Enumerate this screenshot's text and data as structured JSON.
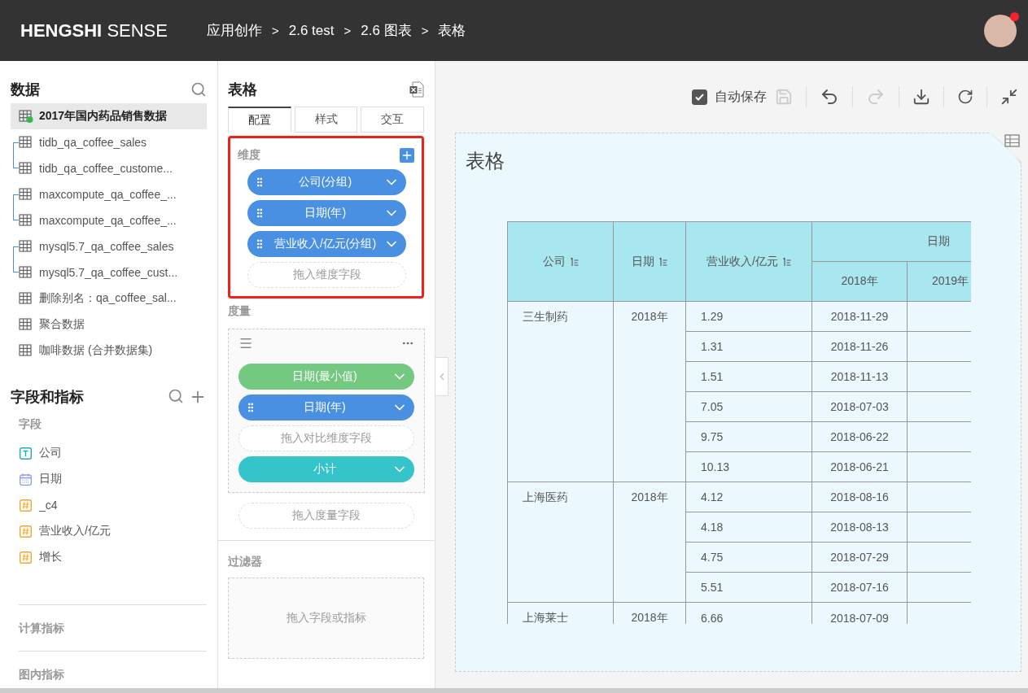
{
  "header": {
    "brand_bold": "HENGSHI",
    "brand_light": "SENSE",
    "separator": ">",
    "breadcrumb": [
      "应用创作",
      "2.6 test",
      "2.6 图表",
      "表格"
    ],
    "notification": true
  },
  "data_panel": {
    "title": "数据",
    "datasets": [
      {
        "kind": "single",
        "name": "2017年国内药品销售数据",
        "selected": true
      },
      {
        "kind": "group",
        "children": [
          {
            "name": "tidb_qa_coffee_sales",
            "selected": false
          },
          {
            "name": "tidb_qa_coffee_custome...",
            "selected": false
          }
        ]
      },
      {
        "kind": "group",
        "children": [
          {
            "name": "maxcompute_qa_coffee_...",
            "selected": false
          },
          {
            "name": "maxcompute_qa_coffee_...",
            "selected": false
          }
        ]
      },
      {
        "kind": "group",
        "children": [
          {
            "name": "mysql5.7_qa_coffee_sales",
            "selected": false
          },
          {
            "name": "mysql5.7_qa_coffee_cust...",
            "selected": false
          }
        ]
      },
      {
        "kind": "single",
        "name": "删除别名：qa_coffee_sal...",
        "selected": false
      },
      {
        "kind": "single",
        "name": "聚合数据",
        "selected": false
      },
      {
        "kind": "single",
        "name": "咖啡数据 (合并数据集)",
        "selected": false
      }
    ]
  },
  "fields_panel": {
    "title": "字段和指标",
    "fields_label": "字段",
    "fields": [
      {
        "name": "公司",
        "kind": "text"
      },
      {
        "name": "日期",
        "kind": "date"
      },
      {
        "name": "_c4",
        "kind": "number"
      },
      {
        "name": "营业收入/亿元",
        "kind": "number"
      },
      {
        "name": "增长",
        "kind": "number"
      }
    ],
    "sections": [
      "计算指标",
      "图内指标"
    ]
  },
  "config_panel": {
    "title": "表格",
    "tabs": [
      {
        "label": "配置",
        "selected": true
      },
      {
        "label": "样式",
        "selected": false
      },
      {
        "label": "交互",
        "selected": false
      }
    ],
    "dimensions": {
      "label": "维度",
      "highlighted": true,
      "pills": [
        "公司(分组)",
        "日期(年)",
        "营业收入/亿元(分组)"
      ],
      "drop_hint": "拖入维度字段"
    },
    "measures": {
      "label": "度量",
      "items": [
        {
          "kind": "measure",
          "label": "日期(最小值)"
        },
        {
          "kind": "dimension",
          "label": "日期(年)"
        },
        {
          "kind": "drop",
          "label": "拖入对比维度字段"
        },
        {
          "kind": "subtotal",
          "label": "小计"
        }
      ],
      "drop_hint": "拖入度量字段"
    },
    "filters": {
      "label": "过滤器",
      "drop_hint": "拖入字段或指标"
    }
  },
  "toolbar": {
    "autosave": {
      "label": "自动保存",
      "checked": true
    }
  },
  "chart": {
    "title": "表格",
    "table": {
      "columns": [
        {
          "label": "公司",
          "sortable": true
        },
        {
          "label": "日期",
          "sortable": true
        },
        {
          "label": "营业收入/亿元",
          "sortable": true
        }
      ],
      "group_header": "日期",
      "sub_columns": [
        "2018年",
        "2019年"
      ],
      "groups": [
        {
          "company": "三生制药",
          "year": "2018年",
          "rows": [
            {
              "value": "1.29",
              "date": "2018-11-29"
            },
            {
              "value": "1.31",
              "date": "2018-11-26"
            },
            {
              "value": "1.51",
              "date": "2018-11-13"
            },
            {
              "value": "7.05",
              "date": "2018-07-03"
            },
            {
              "value": "9.75",
              "date": "2018-06-22"
            },
            {
              "value": "10.13",
              "date": "2018-06-21"
            }
          ]
        },
        {
          "company": "上海医药",
          "year": "2018年",
          "rows": [
            {
              "value": "4.12",
              "date": "2018-08-16"
            },
            {
              "value": "4.18",
              "date": "2018-08-13"
            },
            {
              "value": "4.75",
              "date": "2018-07-29"
            },
            {
              "value": "5.51",
              "date": "2018-07-16"
            }
          ]
        },
        {
          "company": "上海莱士",
          "year": "2018年",
          "rows": [
            {
              "value": "6.66",
              "date": "2018-07-09"
            }
          ]
        }
      ]
    }
  }
}
